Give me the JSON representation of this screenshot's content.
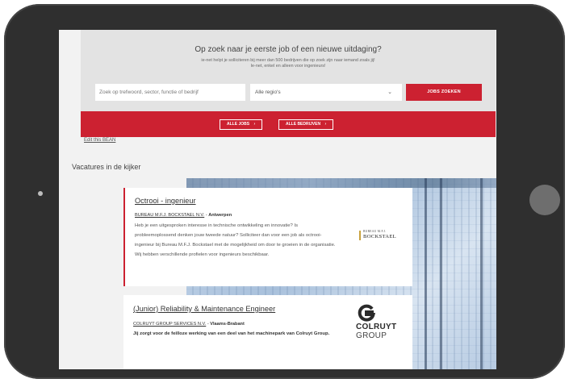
{
  "hero": {
    "title": "Op zoek naar je eerste job of een nieuwe uitdaging?",
    "subtitle_line1": "ie-net helpt je solliciteren bij meer dan 500 bedrijven die op zoek zijn naar iemand zoals jij!",
    "subtitle_line2": "Ie-net, enkel en alleen voor ingenieurs!",
    "search_placeholder": "Zoek op trefwoord, sector, functie of bedrijf",
    "region_value": "Alle regio's",
    "search_button": "JOBS ZOEKEN"
  },
  "band": {
    "all_jobs": "ALLE JOBS",
    "all_companies": "ALLE BEDRIJVEN",
    "arrow": "›"
  },
  "edit_link": "Edit this BEAN",
  "section_title": "Vacatures in de kijker",
  "jobs": [
    {
      "title": "Octrooi - ingenieur",
      "company": "BUREAU M.F.J. BOCKSTAEL N.V.",
      "separator": " - ",
      "location": "Antwerpen",
      "description": "Heb je een uitgesproken interesse in technische ontwikkeling en innovatie? Is probleemoplossend denken jouw tweede natuur? Solliciteer dan voor een job als octrooi-ingenieur bij Bureau M.F.J. Bockstael met de mogelijkheid om door te groeien in de organisatie. Wij hebben verschillende profielen voor ingenieurs beschikbaar.",
      "logo_small": "BUREAU M.F.J.",
      "logo_big": "BOCKSTAEL"
    },
    {
      "title": "(Junior) Reliability & Maintenance Engineer",
      "company": "COLRUYT GROUP SERVICES N.V.",
      "separator": " - ",
      "location": "Vlaams-Brabant",
      "description": "Jij zorgt voor de feilloze werking van een deel van het machinepark van Colruyt Group.",
      "logo_line1": "COLRUYT",
      "logo_line2": "GROUP"
    }
  ],
  "colors": {
    "brand_red": "#cc2131",
    "tablet_frame": "#2f2f2f",
    "accent_gold": "#c9a23d"
  },
  "icons": {
    "dropdown": "chevron-down-icon",
    "arrow": "arrow-right-icon"
  }
}
